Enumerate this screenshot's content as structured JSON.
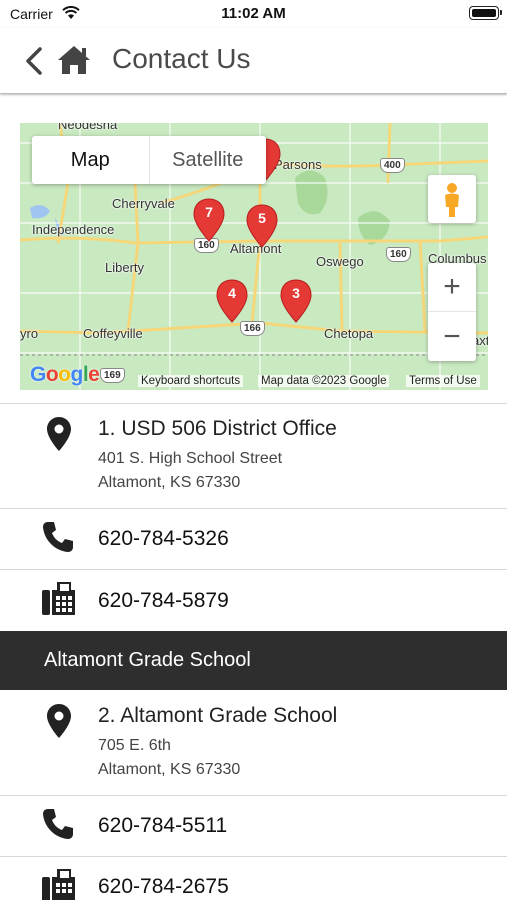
{
  "status_bar": {
    "carrier": "Carrier",
    "time": "11:02 AM"
  },
  "header": {
    "title": "Contact Us",
    "back_icon": "chevron-left-icon",
    "home_icon": "home-icon"
  },
  "map": {
    "type_buttons": {
      "map": "Map",
      "satellite": "Satellite"
    },
    "towns": [
      "Neodesha",
      "Cherryvale",
      "Independence",
      "Liberty",
      "Altamont",
      "Oswego",
      "Columbus",
      "Coffeyville",
      "Chetopa",
      "Parsons",
      "yro",
      "axt"
    ],
    "markers": [
      "7",
      "5",
      "4",
      "3"
    ],
    "route_shields": [
      "400",
      "160",
      "160",
      "166",
      "169"
    ],
    "logo": "Google",
    "attribution": {
      "shortcuts": "Keyboard shortcuts",
      "data": "Map data ©2023 Google",
      "terms": "Terms of Use"
    },
    "controls": {
      "zoom_in": "+",
      "zoom_out": "−",
      "pegman_icon": "street-view-pegman-icon"
    },
    "colors": {
      "land": "#c9e9c1",
      "marker": "#e53935",
      "road": "#f5d77a"
    }
  },
  "locations": [
    {
      "name": "1. USD 506 District Office",
      "address_line1": "401 S. High School Street",
      "address_line2": "Altamont, KS  67330",
      "phone": "620-784-5326",
      "fax": "620-784-5879"
    },
    {
      "section": "Altamont Grade School",
      "name": "2. Altamont Grade School",
      "address_line1": "705 E. 6th",
      "address_line2": "Altamont, KS  67330",
      "phone": "620-784-5511",
      "fax": "620-784-2675"
    }
  ],
  "colors": {
    "section_header_bg": "#2e2e2e",
    "title_text": "#4a4a4a"
  }
}
